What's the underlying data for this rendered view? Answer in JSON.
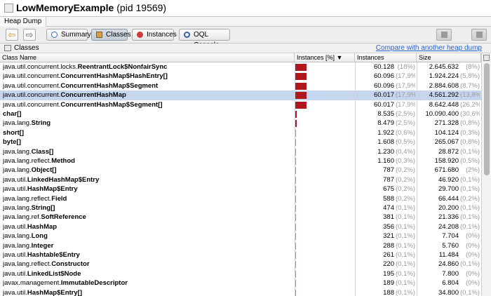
{
  "window": {
    "app_name": "LowMemoryExample",
    "pid_text": "(pid 19569)"
  },
  "subtab": {
    "label": "Heap Dump"
  },
  "toolbar": {
    "back_glyph": "⇦",
    "forward_glyph": "⇨",
    "summary_label": "Summary",
    "classes_label": "Classes",
    "instances_label": "Instances",
    "oql_label": "OQL Console"
  },
  "section": {
    "title": "Classes",
    "compare_link": "Compare with another heap dump"
  },
  "columns": {
    "name": "Class Name",
    "instances_pct": "Instances [%] ▼",
    "instances": "Instances",
    "size": "Size"
  },
  "accent": {
    "bar": "#b0171c",
    "selection": "#c5d6ee",
    "link": "#2a64c8"
  },
  "rows": [
    {
      "pkg": "java.util.concurrent.locks.",
      "cls": "ReentrantLock$NonfairSync",
      "share": 0.18,
      "instances": "60.128",
      "ipct": "(18%)",
      "size": "2.645.632",
      "spct": "(8%)"
    },
    {
      "pkg": "java.util.concurrent.",
      "cls": "ConcurrentHashMap$HashEntry[]",
      "share": 0.179,
      "instances": "60.096",
      "ipct": "(17,9%)",
      "size": "1.924.224",
      "spct": "(5,8%)"
    },
    {
      "pkg": "java.util.concurrent.",
      "cls": "ConcurrentHashMap$Segment",
      "share": 0.179,
      "instances": "60.096",
      "ipct": "(17,9%)",
      "size": "2.884.608",
      "spct": "(8,7%)"
    },
    {
      "pkg": "java.util.concurrent.",
      "cls": "ConcurrentHashMap",
      "share": 0.179,
      "instances": "60.017",
      "ipct": "(17,9%)",
      "size": "4.561.292",
      "spct": "(13,8%)",
      "selected": true
    },
    {
      "pkg": "java.util.concurrent.",
      "cls": "ConcurrentHashMap$Segment[]",
      "share": 0.179,
      "instances": "60.017",
      "ipct": "(17,9%)",
      "size": "8.642.448",
      "spct": "(26,2%)"
    },
    {
      "pkg": "",
      "cls": "char[]",
      "share": 0.025,
      "instances": "8.535",
      "ipct": "(2,5%)",
      "size": "10.090.400",
      "spct": "(30,6%)"
    },
    {
      "pkg": "java.lang.",
      "cls": "String",
      "share": 0.025,
      "instances": "8.479",
      "ipct": "(2,5%)",
      "size": "271.328",
      "spct": "(0,8%)"
    },
    {
      "pkg": "",
      "cls": "short[]",
      "share": 0.006,
      "instances": "1.922",
      "ipct": "(0,6%)",
      "size": "104.124",
      "spct": "(0,3%)"
    },
    {
      "pkg": "",
      "cls": "byte[]",
      "share": 0.005,
      "instances": "1.608",
      "ipct": "(0,5%)",
      "size": "265.067",
      "spct": "(0,8%)"
    },
    {
      "pkg": "java.lang.",
      "cls": "Class[]",
      "share": 0.004,
      "instances": "1.230",
      "ipct": "(0,4%)",
      "size": "28.872",
      "spct": "(0,1%)"
    },
    {
      "pkg": "java.lang.reflect.",
      "cls": "Method",
      "share": 0.003,
      "instances": "1.160",
      "ipct": "(0,3%)",
      "size": "158.920",
      "spct": "(0,5%)"
    },
    {
      "pkg": "java.lang.",
      "cls": "Object[]",
      "share": 0.002,
      "instances": "787",
      "ipct": "(0,2%)",
      "size": "671.680",
      "spct": "(2%)"
    },
    {
      "pkg": "java.util.",
      "cls": "LinkedHashMap$Entry",
      "share": 0.002,
      "instances": "787",
      "ipct": "(0,2%)",
      "size": "46.920",
      "spct": "(0,1%)"
    },
    {
      "pkg": "java.util.",
      "cls": "HashMap$Entry",
      "share": 0.002,
      "instances": "675",
      "ipct": "(0,2%)",
      "size": "29.700",
      "spct": "(0,1%)"
    },
    {
      "pkg": "java.lang.reflect.",
      "cls": "Field",
      "share": 0.002,
      "instances": "588",
      "ipct": "(0,2%)",
      "size": "66.444",
      "spct": "(0,2%)"
    },
    {
      "pkg": "java.lang.",
      "cls": "String[]",
      "share": 0.001,
      "instances": "474",
      "ipct": "(0,1%)",
      "size": "20.200",
      "spct": "(0,1%)"
    },
    {
      "pkg": "java.lang.ref.",
      "cls": "SoftReference",
      "share": 0.001,
      "instances": "381",
      "ipct": "(0,1%)",
      "size": "21.336",
      "spct": "(0,1%)"
    },
    {
      "pkg": "java.util.",
      "cls": "HashMap",
      "share": 0.001,
      "instances": "356",
      "ipct": "(0,1%)",
      "size": "24.208",
      "spct": "(0,1%)"
    },
    {
      "pkg": "java.lang.",
      "cls": "Long",
      "share": 0.001,
      "instances": "321",
      "ipct": "(0,1%)",
      "size": "7.704",
      "spct": "(0%)"
    },
    {
      "pkg": "java.lang.",
      "cls": "Integer",
      "share": 0.001,
      "instances": "288",
      "ipct": "(0,1%)",
      "size": "5.760",
      "spct": "(0%)"
    },
    {
      "pkg": "java.util.",
      "cls": "Hashtable$Entry",
      "share": 0.001,
      "instances": "261",
      "ipct": "(0,1%)",
      "size": "11.484",
      "spct": "(0%)"
    },
    {
      "pkg": "java.lang.reflect.",
      "cls": "Constructor",
      "share": 0.001,
      "instances": "220",
      "ipct": "(0,1%)",
      "size": "24.860",
      "spct": "(0,1%)"
    },
    {
      "pkg": "java.util.",
      "cls": "LinkedList$Node",
      "share": 0.001,
      "instances": "195",
      "ipct": "(0,1%)",
      "size": "7.800",
      "spct": "(0%)"
    },
    {
      "pkg": "javax.management.",
      "cls": "ImmutableDescriptor",
      "share": 0.001,
      "instances": "189",
      "ipct": "(0,1%)",
      "size": "6.804",
      "spct": "(0%)"
    },
    {
      "pkg": "java.util.",
      "cls": "HashMap$Entry[]",
      "share": 0.001,
      "instances": "188",
      "ipct": "(0,1%)",
      "size": "34.800",
      "spct": "(0,1%)"
    }
  ]
}
